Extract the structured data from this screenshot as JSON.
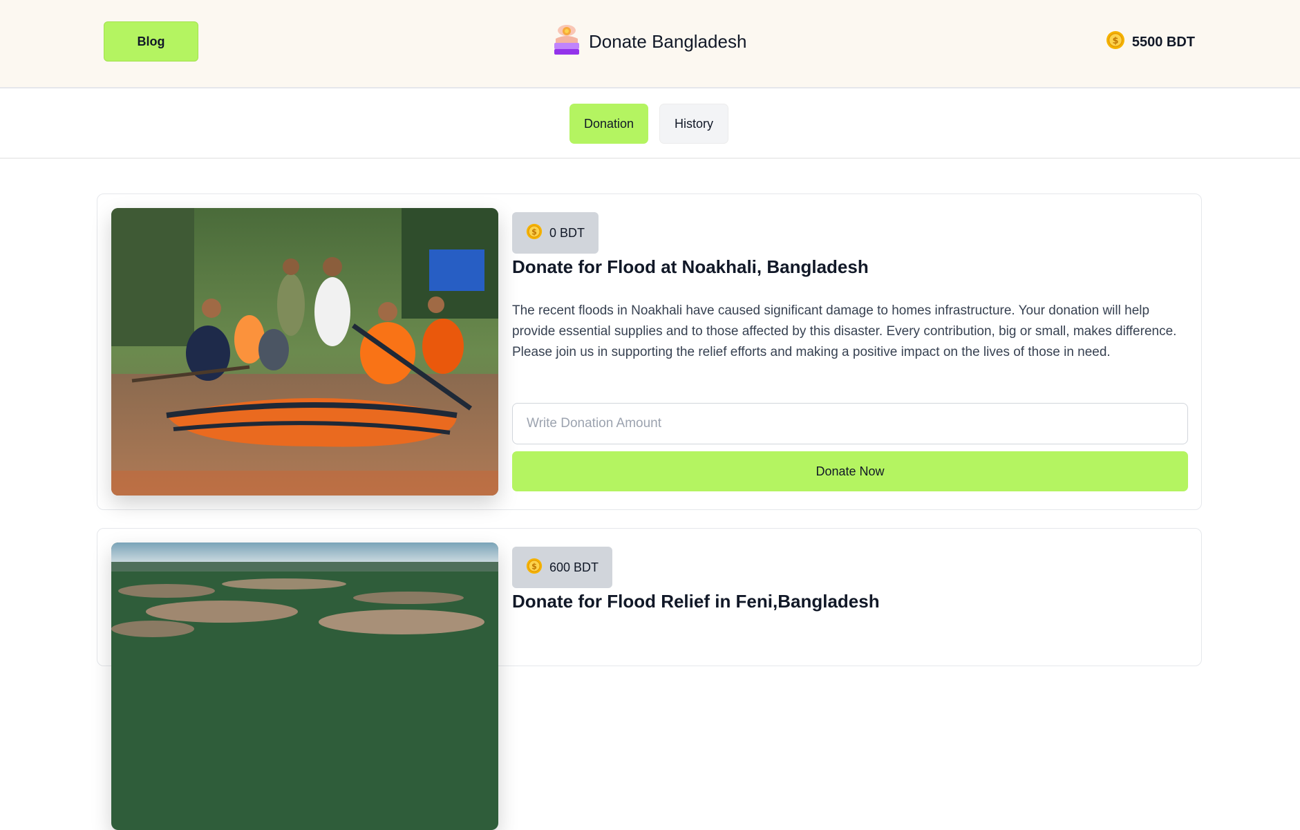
{
  "header": {
    "blog_label": "Blog",
    "brand_title": "Donate Bangladesh",
    "balance": "5500 BDT"
  },
  "tabs": [
    {
      "label": "Donation",
      "active": true
    },
    {
      "label": "History",
      "active": false
    }
  ],
  "cards": [
    {
      "amount": "0 BDT",
      "title": "Donate for Flood at Noakhali, Bangladesh",
      "description": "The recent floods in Noakhali have caused significant damage to homes infrastructure. Your donation will help provide essential supplies and to those affected by this disaster. Every contribution, big or small, makes difference. Please join us in supporting the relief efforts and making a positive impact on the lives of those in need.",
      "input_placeholder": "Write Donation Amount",
      "button_label": "Donate Now"
    },
    {
      "amount": "600 BDT",
      "title": "Donate for Flood Relief in Feni,Bangladesh"
    }
  ],
  "colors": {
    "accent": "#b4f461",
    "header_bg": "#fcf8f1",
    "badge_bg": "#d1d5db",
    "coin": "#f5b301"
  },
  "icons": {
    "brand": "donation-hand-icon",
    "coin": "coin-icon"
  }
}
